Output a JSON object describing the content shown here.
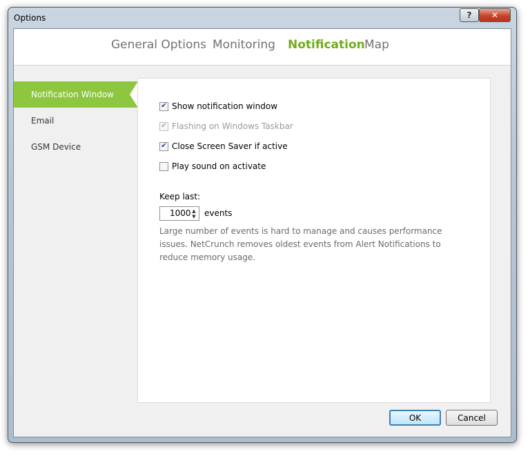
{
  "window": {
    "title": "Options"
  },
  "titlebar": {
    "help_label": "?",
    "close_label": "✕"
  },
  "tabs": [
    {
      "label": "General Options",
      "active": false
    },
    {
      "label": "Monitoring",
      "active": false
    },
    {
      "label": "Notification",
      "active": true
    },
    {
      "label": "Map",
      "active": false
    }
  ],
  "sidebar": {
    "items": [
      {
        "label": "Notification Window",
        "active": true
      },
      {
        "label": "Email",
        "active": false
      },
      {
        "label": "GSM Device",
        "active": false
      }
    ]
  },
  "panel": {
    "options": [
      {
        "label": "Show notification window",
        "checked": true,
        "enabled": true
      },
      {
        "label": "Flashing on Windows Taskbar",
        "checked": true,
        "enabled": false
      },
      {
        "label": "Close Screen Saver if active",
        "checked": true,
        "enabled": true
      },
      {
        "label": "Play sound on activate",
        "checked": false,
        "enabled": true
      }
    ],
    "keep_last_label": "Keep last:",
    "keep_last_value": "1000",
    "events_label": "events",
    "hint": "Large number of events is hard to manage and causes performance issues. NetCrunch removes oldest events from Alert Notifications to reduce memory usage."
  },
  "buttons": {
    "ok_label": "OK",
    "cancel_label": "Cancel"
  },
  "colors": {
    "accent": "#8dc63f",
    "active_tab": "#6fad1d",
    "close_button": "#c7442a"
  }
}
